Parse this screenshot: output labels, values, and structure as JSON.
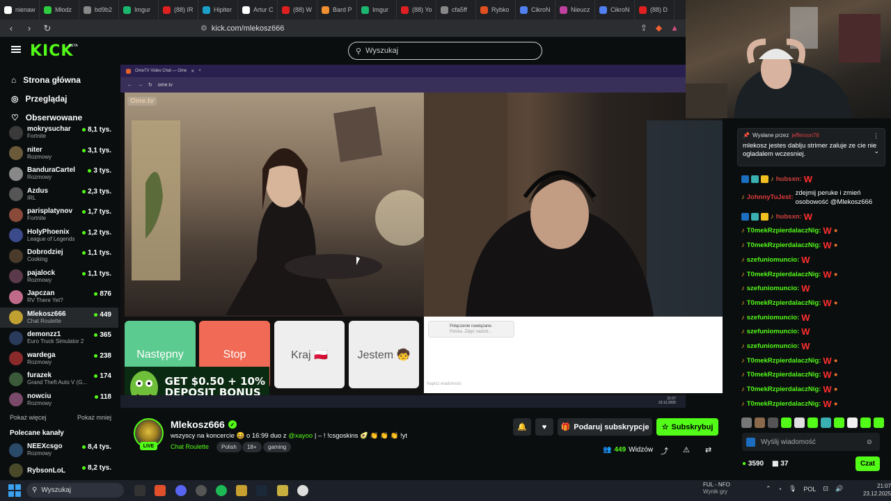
{
  "browser": {
    "tabs": [
      "nienaw",
      "Młodz",
      "bd9b2",
      "Imgur",
      "(88) IR",
      "Hipiter",
      "Artur C",
      "(88) W",
      "Bard P",
      "Imgur",
      "(88) Yo",
      "cfa5ff",
      "Rybko",
      "CikroN",
      "Nieucz",
      "CikroN",
      "(88) D"
    ],
    "url": "kick.com/mlekosz666"
  },
  "header": {
    "logo": "KICK",
    "beta": "BETA",
    "search_placeholder": "Wyszukaj"
  },
  "sidebar": {
    "nav": [
      "Strona główna",
      "Przeglądaj",
      "Obserwowane"
    ],
    "channels": [
      {
        "name": "mokrysuchar",
        "category": "Fortnite",
        "viewers": "8,1 tys.",
        "color": "#3a3a3a"
      },
      {
        "name": "niter",
        "category": "Rozmowy",
        "viewers": "3,1 tys.",
        "color": "#6b5a3a"
      },
      {
        "name": "BanduraCartel",
        "category": "Rozmowy",
        "viewers": "3 tys.",
        "color": "#888888"
      },
      {
        "name": "Azdus",
        "category": "IRL",
        "viewers": "2,3 tys.",
        "color": "#555555"
      },
      {
        "name": "parisplatynov",
        "category": "Fortnite",
        "viewers": "1,7 tys.",
        "color": "#8a4a3a"
      },
      {
        "name": "HolyPhoenix",
        "category": "League of Legends",
        "viewers": "1,2 tys.",
        "color": "#3a4a8a"
      },
      {
        "name": "Dobrodziej",
        "category": "Cooking",
        "viewers": "1,1 tys.",
        "color": "#4a3a2a"
      },
      {
        "name": "pajalock",
        "category": "Rozmowy",
        "viewers": "1,1 tys.",
        "color": "#5a3a4a"
      },
      {
        "name": "Japczan",
        "category": "RV There Yet?",
        "viewers": "876",
        "color": "#c06a8a"
      },
      {
        "name": "Mlekosz666",
        "category": "Chat Roulette",
        "viewers": "449",
        "color": "#c0a030",
        "active": true
      },
      {
        "name": "demonzz1",
        "category": "Euro Truck Simulator 2",
        "viewers": "365",
        "color": "#2a3a5a"
      },
      {
        "name": "wardega",
        "category": "Rozmowy",
        "viewers": "238",
        "color": "#8a2a2a"
      },
      {
        "name": "furazek",
        "category": "Grand Theft Auto V (G...",
        "viewers": "174",
        "color": "#3a5a3a"
      },
      {
        "name": "nowciu",
        "category": "Rozmowy",
        "viewers": "118",
        "color": "#7a4a6a"
      }
    ],
    "show_more": "Pokaż więcej",
    "show_less": "Pokaż mniej",
    "recommended_title": "Polecane kanały",
    "recommended": [
      {
        "name": "NEEXcsgo",
        "category": "Rozmowy",
        "viewers": "8,4 tys.",
        "color": "#2a4a6a"
      },
      {
        "name": "RybsonLoL",
        "category": "",
        "viewers": "8,2 tys.",
        "color": "#4a4a2a"
      }
    ]
  },
  "video": {
    "inner_tab": "OmeTV Video Chat — Ome",
    "inner_url": "ome.tv",
    "watermark": "Ome.tv",
    "buttons": [
      {
        "label": "Następny",
        "bg": "#5ccb8f",
        "fg": "#ffffff"
      },
      {
        "label": "Stop",
        "bg": "#f06a55",
        "fg": "#ffffff"
      },
      {
        "label": "Kraj 🇵🇱",
        "bg": "#eeeeee",
        "fg": "#555555"
      },
      {
        "label": "Jestem 🧒",
        "bg": "#eeeeee",
        "fg": "#555555"
      }
    ],
    "status_line1": "Połączenie nawiązane.",
    "status_line2": "Polska. Zdjęć nadzór...",
    "message_placeholder": "Napisz wiadomość",
    "banner_line1": "GET $0.50 + 10%",
    "banner_line2": "DEPOSIT BONUS",
    "inner_clock": "21:07",
    "inner_date": "23.12.2025"
  },
  "stream": {
    "name": "Mlekosz666",
    "live": "LIVE",
    "title": "wszyscy na koncercie 😆 o 16:99 duo z",
    "mention": "@xayoo",
    "title_rest": "| – ! !csgoskins 🥑 👏 👏 👏 !yt",
    "category": "Chat Roulette",
    "tags": [
      "Polish",
      "18+",
      "gaming"
    ],
    "gift_label": "Podaruj subskrypcje",
    "sub_label": "Subskrybuj",
    "viewers": "449",
    "viewers_label": "Widzów"
  },
  "chat": {
    "pinned_by_label": "Wysłane przez",
    "pinned_by_user": "jefferson76",
    "pinned_msg": "mlekosz jestes dablju strimer zaluje ze cie nie ogladalem wczesniej.",
    "messages": [
      {
        "user": "hubsxn:",
        "color": "#d04040",
        "text": "W",
        "badges": true
      },
      {
        "user": "JohnnyTuJest:",
        "color": "#e03b3b",
        "text": "zdejmij peruke i zmień osobowość @Mlekosz666",
        "badges": false
      },
      {
        "user": "hubsxn:",
        "color": "#d04040",
        "text": "W",
        "badges": true
      },
      {
        "user": "T0mekRzpierdalaczNig:",
        "color": "#53fc18",
        "text": "W",
        "badges": false
      },
      {
        "user": "T0mekRzpierdalaczNig:",
        "color": "#53fc18",
        "text": "W",
        "badges": false
      },
      {
        "user": "szefuniomuncio:",
        "color": "#53fc18",
        "text": "W",
        "badges": false
      },
      {
        "user": "T0mekRzpierdalaczNig:",
        "color": "#53fc18",
        "text": "W",
        "badges": false
      },
      {
        "user": "szefuniomuncio:",
        "color": "#53fc18",
        "text": "W",
        "badges": false
      },
      {
        "user": "T0mekRzpierdalaczNig:",
        "color": "#53fc18",
        "text": "W",
        "badges": false
      },
      {
        "user": "szefuniomuncio:",
        "color": "#53fc18",
        "text": "W",
        "badges": false
      },
      {
        "user": "szefuniomuncio:",
        "color": "#53fc18",
        "text": "W",
        "badges": false
      },
      {
        "user": "szefuniomuncio:",
        "color": "#53fc18",
        "text": "W",
        "badges": false
      },
      {
        "user": "T0mekRzpierdalaczNig:",
        "color": "#53fc18",
        "text": "W",
        "badges": false
      },
      {
        "user": "T0mekRzpierdalaczNig:",
        "color": "#53fc18",
        "text": "W",
        "badges": false
      },
      {
        "user": "T0mekRzpierdalaczNig:",
        "color": "#53fc18",
        "text": "W",
        "badges": false
      },
      {
        "user": "T0mekRzpierdalaczNig:",
        "color": "#53fc18",
        "text": "W",
        "badges": false
      }
    ],
    "send_placeholder": "Wyślij wiadomość",
    "points": "3590",
    "gifts": "37",
    "chat_button": "Czat"
  },
  "taskbar": {
    "search": "Wyszukaj",
    "media_title": "FUL - NFO",
    "media_sub": "Wynik gry",
    "lang": "POL",
    "time": "21:07",
    "date": "23.12.2025"
  },
  "colors": {
    "accent": "#53fc18",
    "bg": "#0b0e0f",
    "panel": "#26292c"
  }
}
